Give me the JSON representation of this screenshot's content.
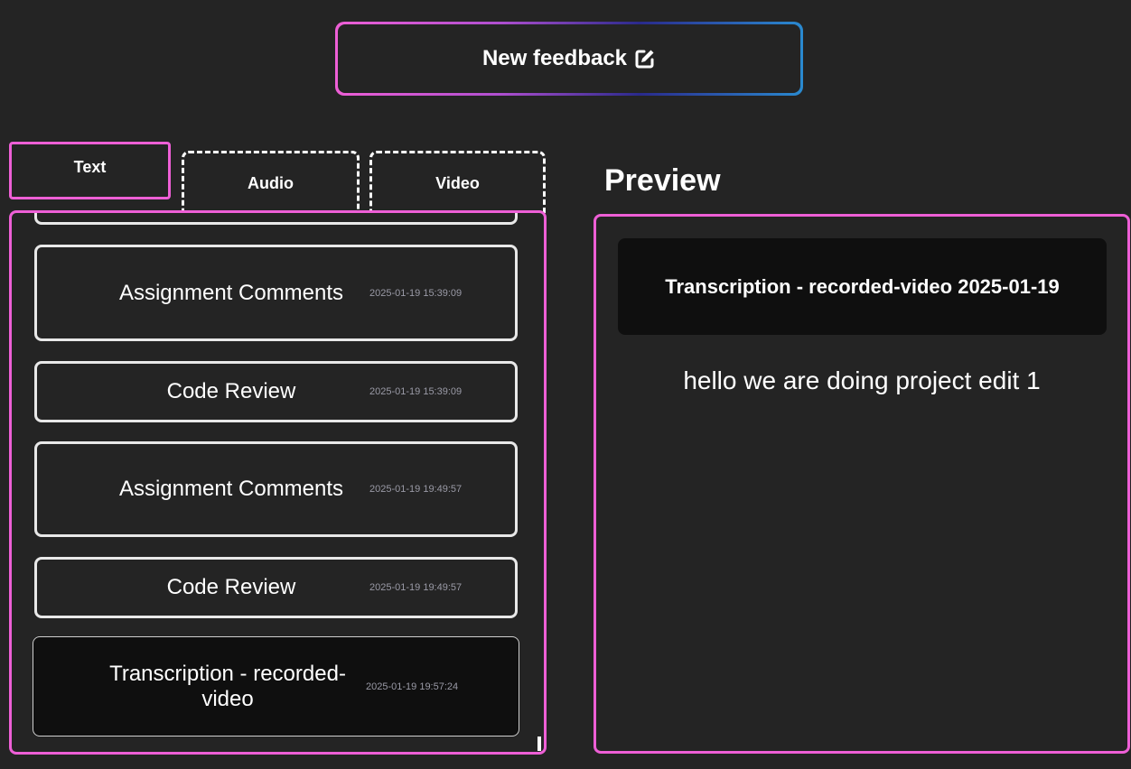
{
  "header": {
    "new_feedback_label": "New feedback",
    "new_feedback_icon": "edit-square-icon"
  },
  "tabs": [
    {
      "label": "Text",
      "active": true
    },
    {
      "label": "Audio",
      "active": false
    },
    {
      "label": "Video",
      "active": false
    }
  ],
  "feedback_list": [
    {
      "title": "Assignment Comments",
      "timestamp": "2025-01-19 15:39:09"
    },
    {
      "title": "Code Review",
      "timestamp": "2025-01-19 15:39:09"
    },
    {
      "title": "Assignment Comments",
      "timestamp": "2025-01-19 19:49:57"
    },
    {
      "title": "Code Review",
      "timestamp": "2025-01-19 19:49:57"
    },
    {
      "title": "Transcription - recorded-video",
      "timestamp": "2025-01-19 19:57:24",
      "selected": true
    }
  ],
  "preview": {
    "heading": "Preview",
    "title": "Transcription - recorded-video 2025-01-19",
    "body": "hello we are doing project edit 1"
  },
  "colors": {
    "background": "#242424",
    "accent": "#ee5fd6",
    "selected_bg": "#0f0f0f",
    "timestamp": "#9a9aa6"
  }
}
